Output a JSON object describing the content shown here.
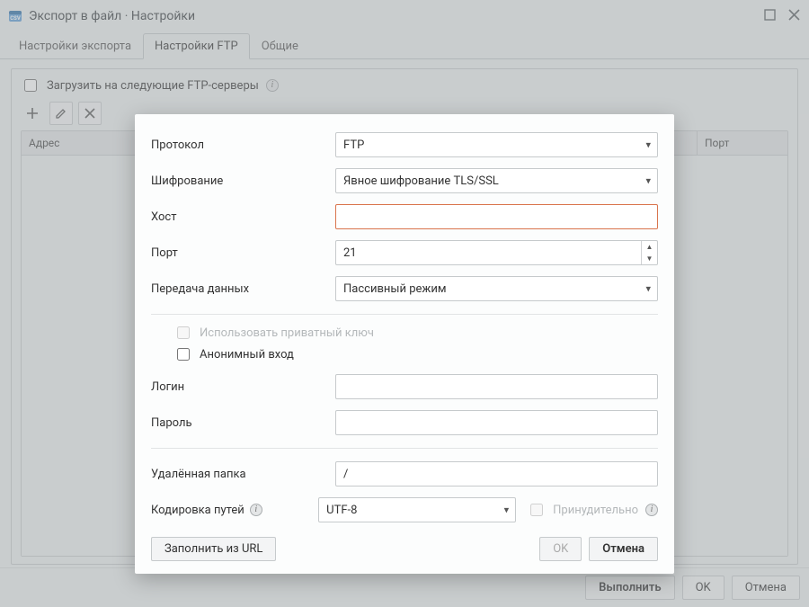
{
  "window": {
    "title": "Экспорт в файл · Настройки",
    "tabs": [
      "Настройки экспорта",
      "Настройки FTP",
      "Общие"
    ],
    "active_tab": 1,
    "upload_label": "Загрузить на следующие FTP-серверы",
    "table_headers": {
      "address": "Адрес",
      "port": "Порт"
    }
  },
  "footer": {
    "run": "Выполнить",
    "ok": "OK",
    "cancel": "Отмена"
  },
  "modal": {
    "labels": {
      "protocol": "Протокол",
      "encryption": "Шифрование",
      "host": "Хост",
      "port": "Порт",
      "transfer": "Передача данных",
      "use_key": "Использовать приватный ключ",
      "anon": "Анонимный вход",
      "login": "Логин",
      "password": "Пароль",
      "remote_dir": "Удалённая папка",
      "path_encoding": "Кодировка путей",
      "force": "Принудительно",
      "fill_url": "Заполнить из URL",
      "ok": "OK",
      "cancel": "Отмена"
    },
    "values": {
      "protocol": "FTP",
      "encryption": "Явное шифрование TLS/SSL",
      "host": "",
      "port": "21",
      "transfer": "Пассивный режим",
      "login": "",
      "password": "",
      "remote_dir": "/",
      "path_encoding": "UTF-8"
    }
  }
}
